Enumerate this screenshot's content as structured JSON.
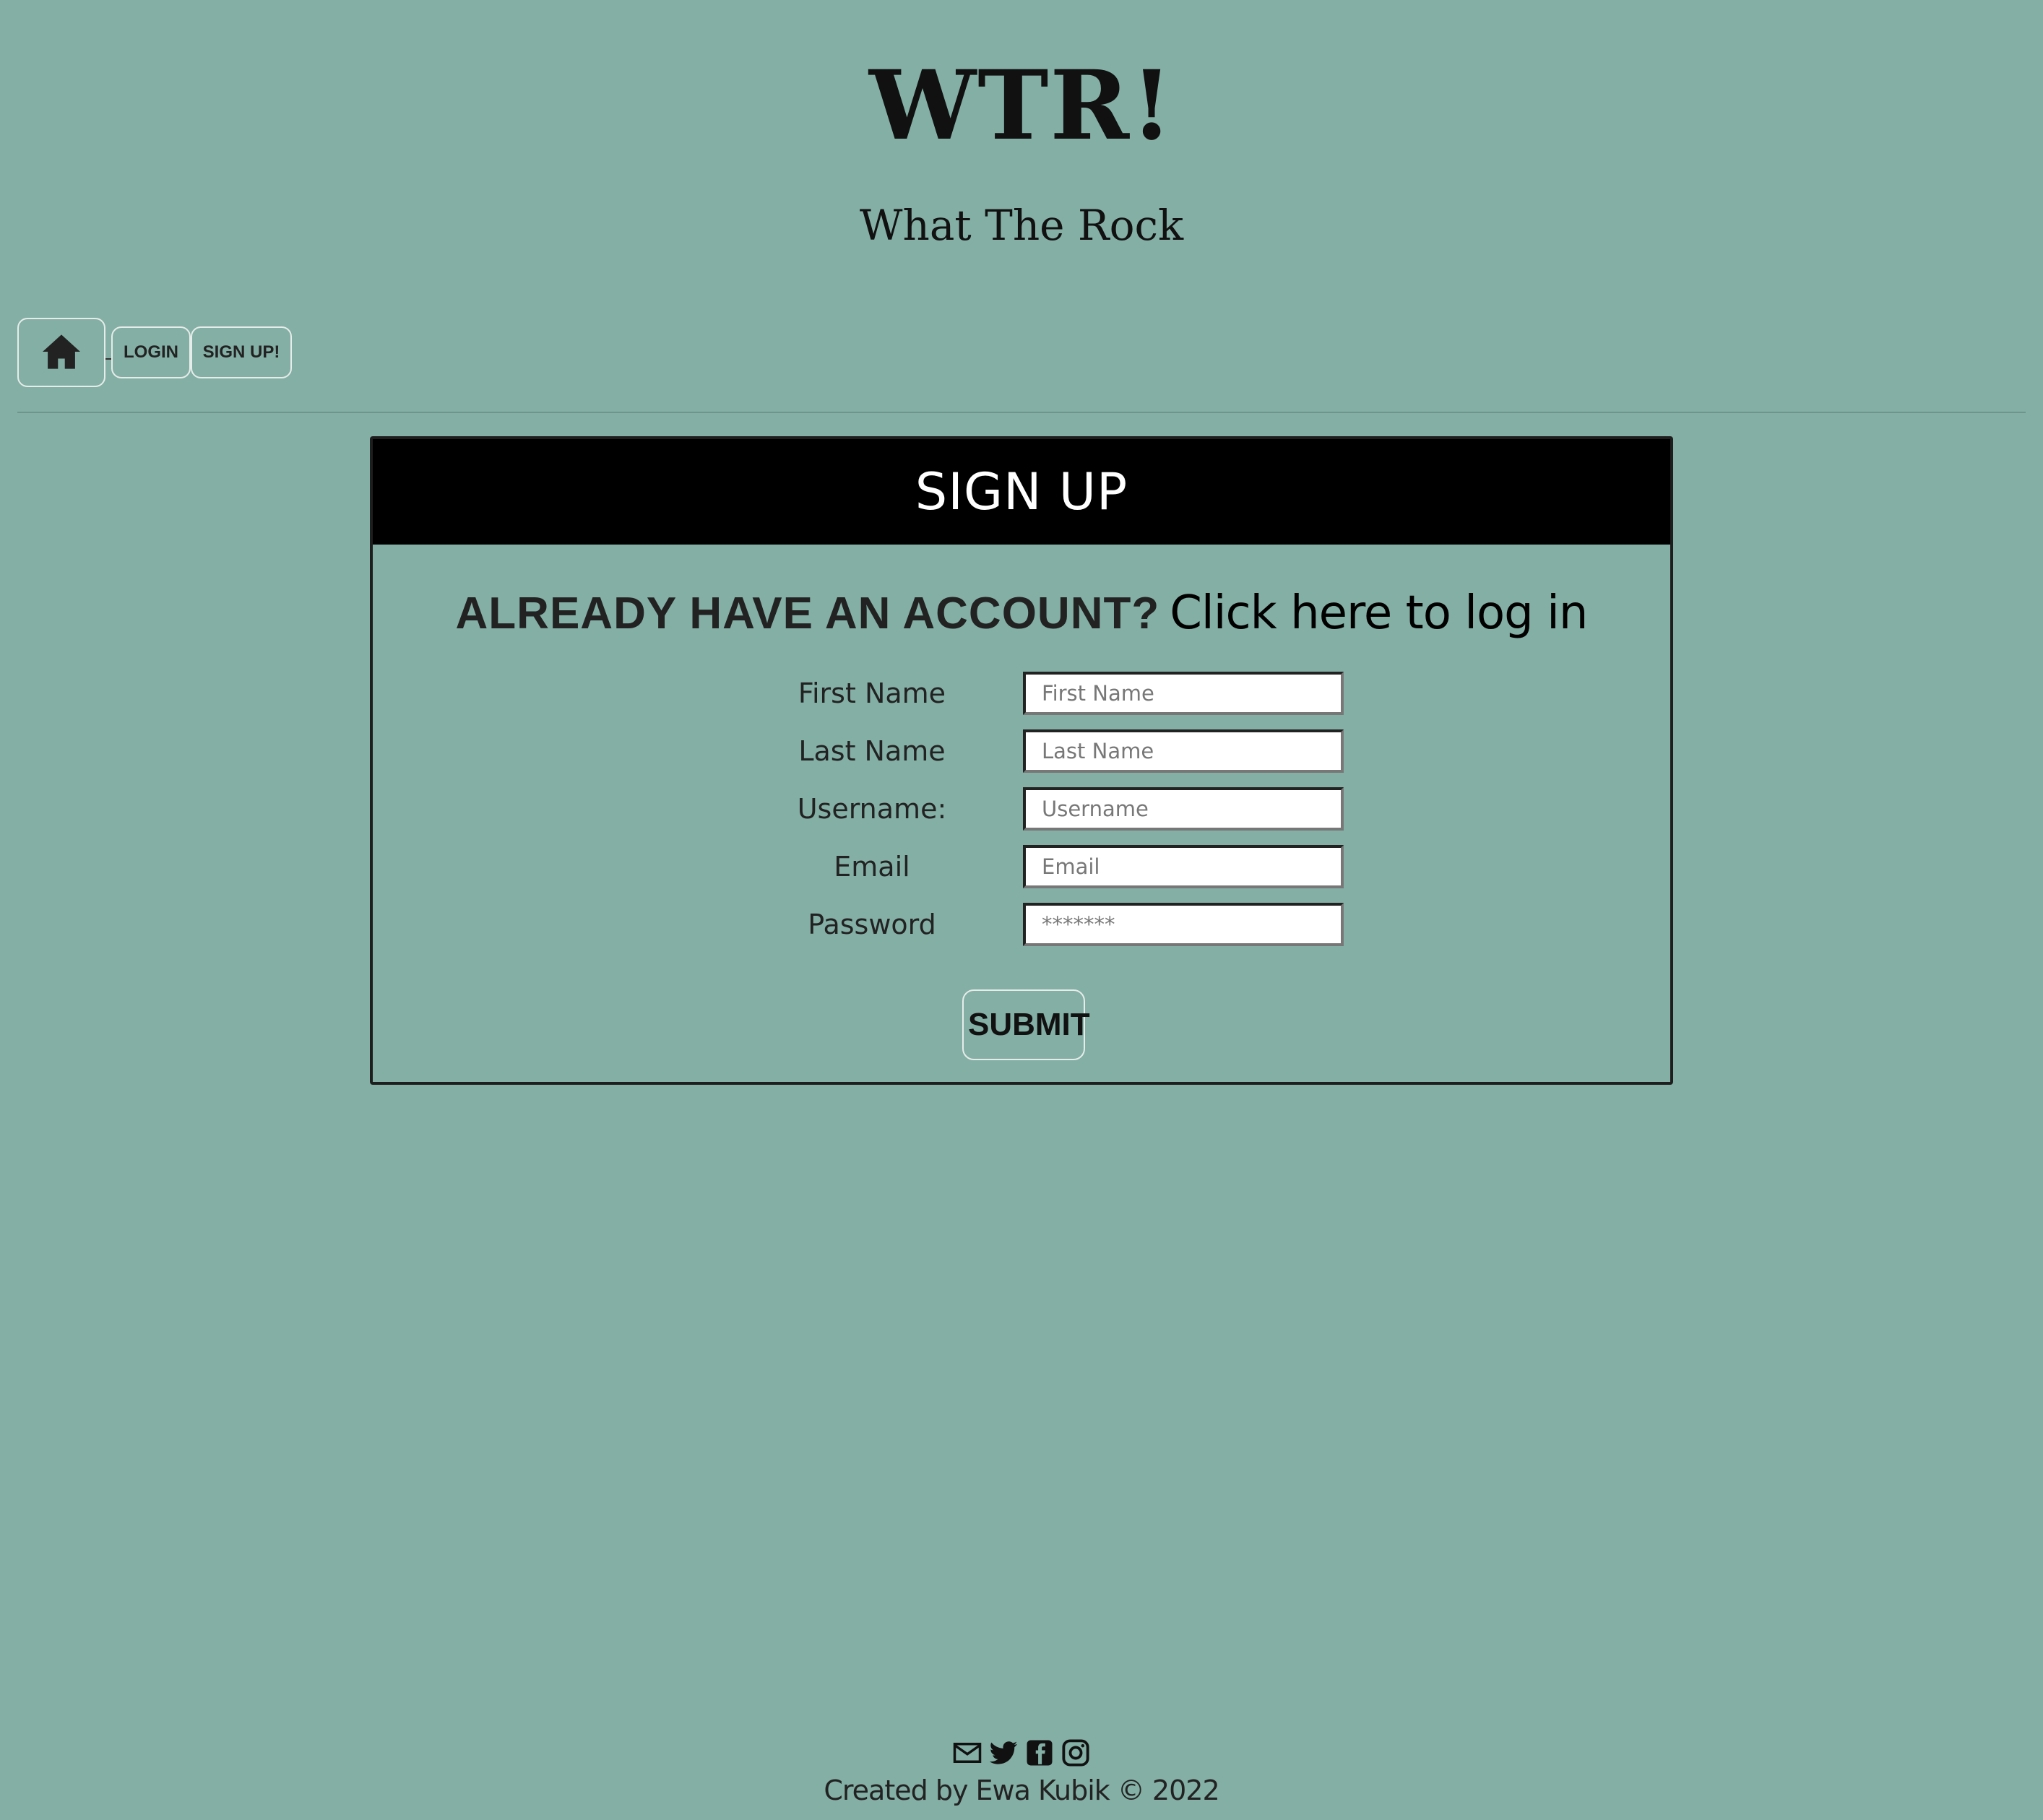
{
  "header": {
    "title": "WTR!",
    "subtitle": "What The Rock"
  },
  "nav": {
    "home_icon": "home-icon",
    "login_label": "LOGIN",
    "signup_label": "SIGN UP!"
  },
  "card": {
    "title": "SIGN UP",
    "already_question": "ALREADY HAVE AN ACCOUNT?",
    "login_link": "Click here to log in",
    "fields": [
      {
        "label": "First Name",
        "placeholder": "First Name"
      },
      {
        "label": "Last Name",
        "placeholder": "Last Name"
      },
      {
        "label": "Username:",
        "placeholder": "Username"
      },
      {
        "label": "Email",
        "placeholder": "Email"
      },
      {
        "label": "Password",
        "placeholder": "*******"
      }
    ],
    "submit_label": "SUBMIT"
  },
  "footer": {
    "icons": [
      "email-icon",
      "twitter-icon",
      "facebook-icon",
      "instagram-icon"
    ],
    "credit": "Created by Ewa Kubik © 2022"
  },
  "colors": {
    "background": "#84afa5",
    "header_bar": "#000000",
    "text": "#212529"
  }
}
